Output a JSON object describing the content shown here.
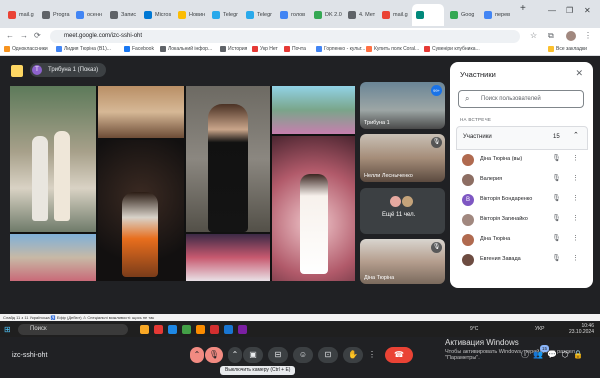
{
  "browser": {
    "tabs": [
      {
        "label": "mail.g",
        "color": "#ea4335"
      },
      {
        "label": "Progra",
        "color": "#5f6368"
      },
      {
        "label": "осенн",
        "color": "#4285f4"
      },
      {
        "label": "Запис",
        "color": "#5f6368"
      },
      {
        "label": "Micros",
        "color": "#0078d4"
      },
      {
        "label": "Новин",
        "color": "#fbbc04"
      },
      {
        "label": "Telegr",
        "color": "#29a9eb"
      },
      {
        "label": "Telegr",
        "color": "#29a9eb"
      },
      {
        "label": "голов",
        "color": "#4285f4"
      },
      {
        "label": "DK 2.0",
        "color": "#34a853"
      },
      {
        "label": "4. Мет",
        "color": "#5f6368"
      },
      {
        "label": "mail.g",
        "color": "#ea4335"
      },
      {
        "label": "",
        "color": "#00897b"
      },
      {
        "label": "Goog",
        "color": "#34a853"
      },
      {
        "label": "перев",
        "color": "#4285f4"
      }
    ],
    "new_tab": "+",
    "window_controls": [
      "—",
      "❐",
      "✕"
    ],
    "nav": [
      "←",
      "→",
      "⟳"
    ],
    "url": "meet.google.com/izc-sshi-oht",
    "bookmarks": [
      {
        "label": "Одноклассники",
        "color": "#f7931e"
      },
      {
        "label": "Лидия Тюріна (В1)...",
        "color": "#4285f4"
      },
      {
        "label": "Facebook",
        "color": "#1877f2"
      },
      {
        "label": "Локальний інфор...",
        "color": "#5f6368"
      },
      {
        "label": "История",
        "color": "#5f6368"
      },
      {
        "label": "Укр Нет",
        "color": "#e53935"
      },
      {
        "label": "Почта",
        "color": "#e53935"
      },
      {
        "label": "Горпенко - культ...",
        "color": "#4285f4"
      },
      {
        "label": "Купить полк Coral...",
        "color": "#ff7043"
      },
      {
        "label": "Сувеніри клубника...",
        "color": "#e53935"
      }
    ],
    "all_bookmarks": "Все закладки"
  },
  "meet": {
    "presenter_initial": "Т",
    "presenter_label": "Трибуна 1 (Показ)",
    "meeting_code": "izc-sshi-oht",
    "tiles": [
      {
        "name": "Трибуна 1",
        "badge": "99+"
      },
      {
        "name": "Нелли Лесныченко"
      },
      {
        "name": "Ещё 11 чел."
      },
      {
        "name": "Діна Тюріна"
      }
    ],
    "tooltip": "Выключить камеру (Ctrl + E)",
    "participants_count_badge": "15"
  },
  "panel": {
    "title": "Участники",
    "close": "✕",
    "search_placeholder": "Поиск пользователей",
    "section": "НА ВСТРЕЧЕ",
    "group_label": "Участники",
    "group_count": "15",
    "people": [
      {
        "name": "Діна Тюріна (вы)",
        "color": "#b06a4f"
      },
      {
        "name": "Валерия",
        "color": "#8d6e63"
      },
      {
        "name": "Вікторія Бондаренко",
        "color": "#7e57c2",
        "initial": "В"
      },
      {
        "name": "Вікторія Загинайко",
        "color": "#a1887f"
      },
      {
        "name": "Діна Тюріна",
        "color": "#b06a4f"
      },
      {
        "name": "Евгения Завада",
        "color": "#6d4c41"
      }
    ]
  },
  "windows": {
    "activate_title": "Активация Windows",
    "activate_text": "Чтобы активировать Windows, перейдите в раздел \"Параметры\"."
  },
  "statusbar": {
    "text": "Слайд 11 з 11    Українська    ♿ Ефір (Дебют)    ⚠ Спеціальні можливості: щось не так"
  },
  "taskbar": {
    "start": "⊞",
    "search": "Поиск",
    "apps": [
      "#f9a825",
      "#e53935",
      "#1e88e5",
      "#43a047",
      "#fb8c00",
      "#d32f2f",
      "#1976d2",
      "#7b1fa2"
    ],
    "weather": "9°C",
    "lang": "УКР",
    "time": "10:46",
    "date": "23.10.2024"
  }
}
